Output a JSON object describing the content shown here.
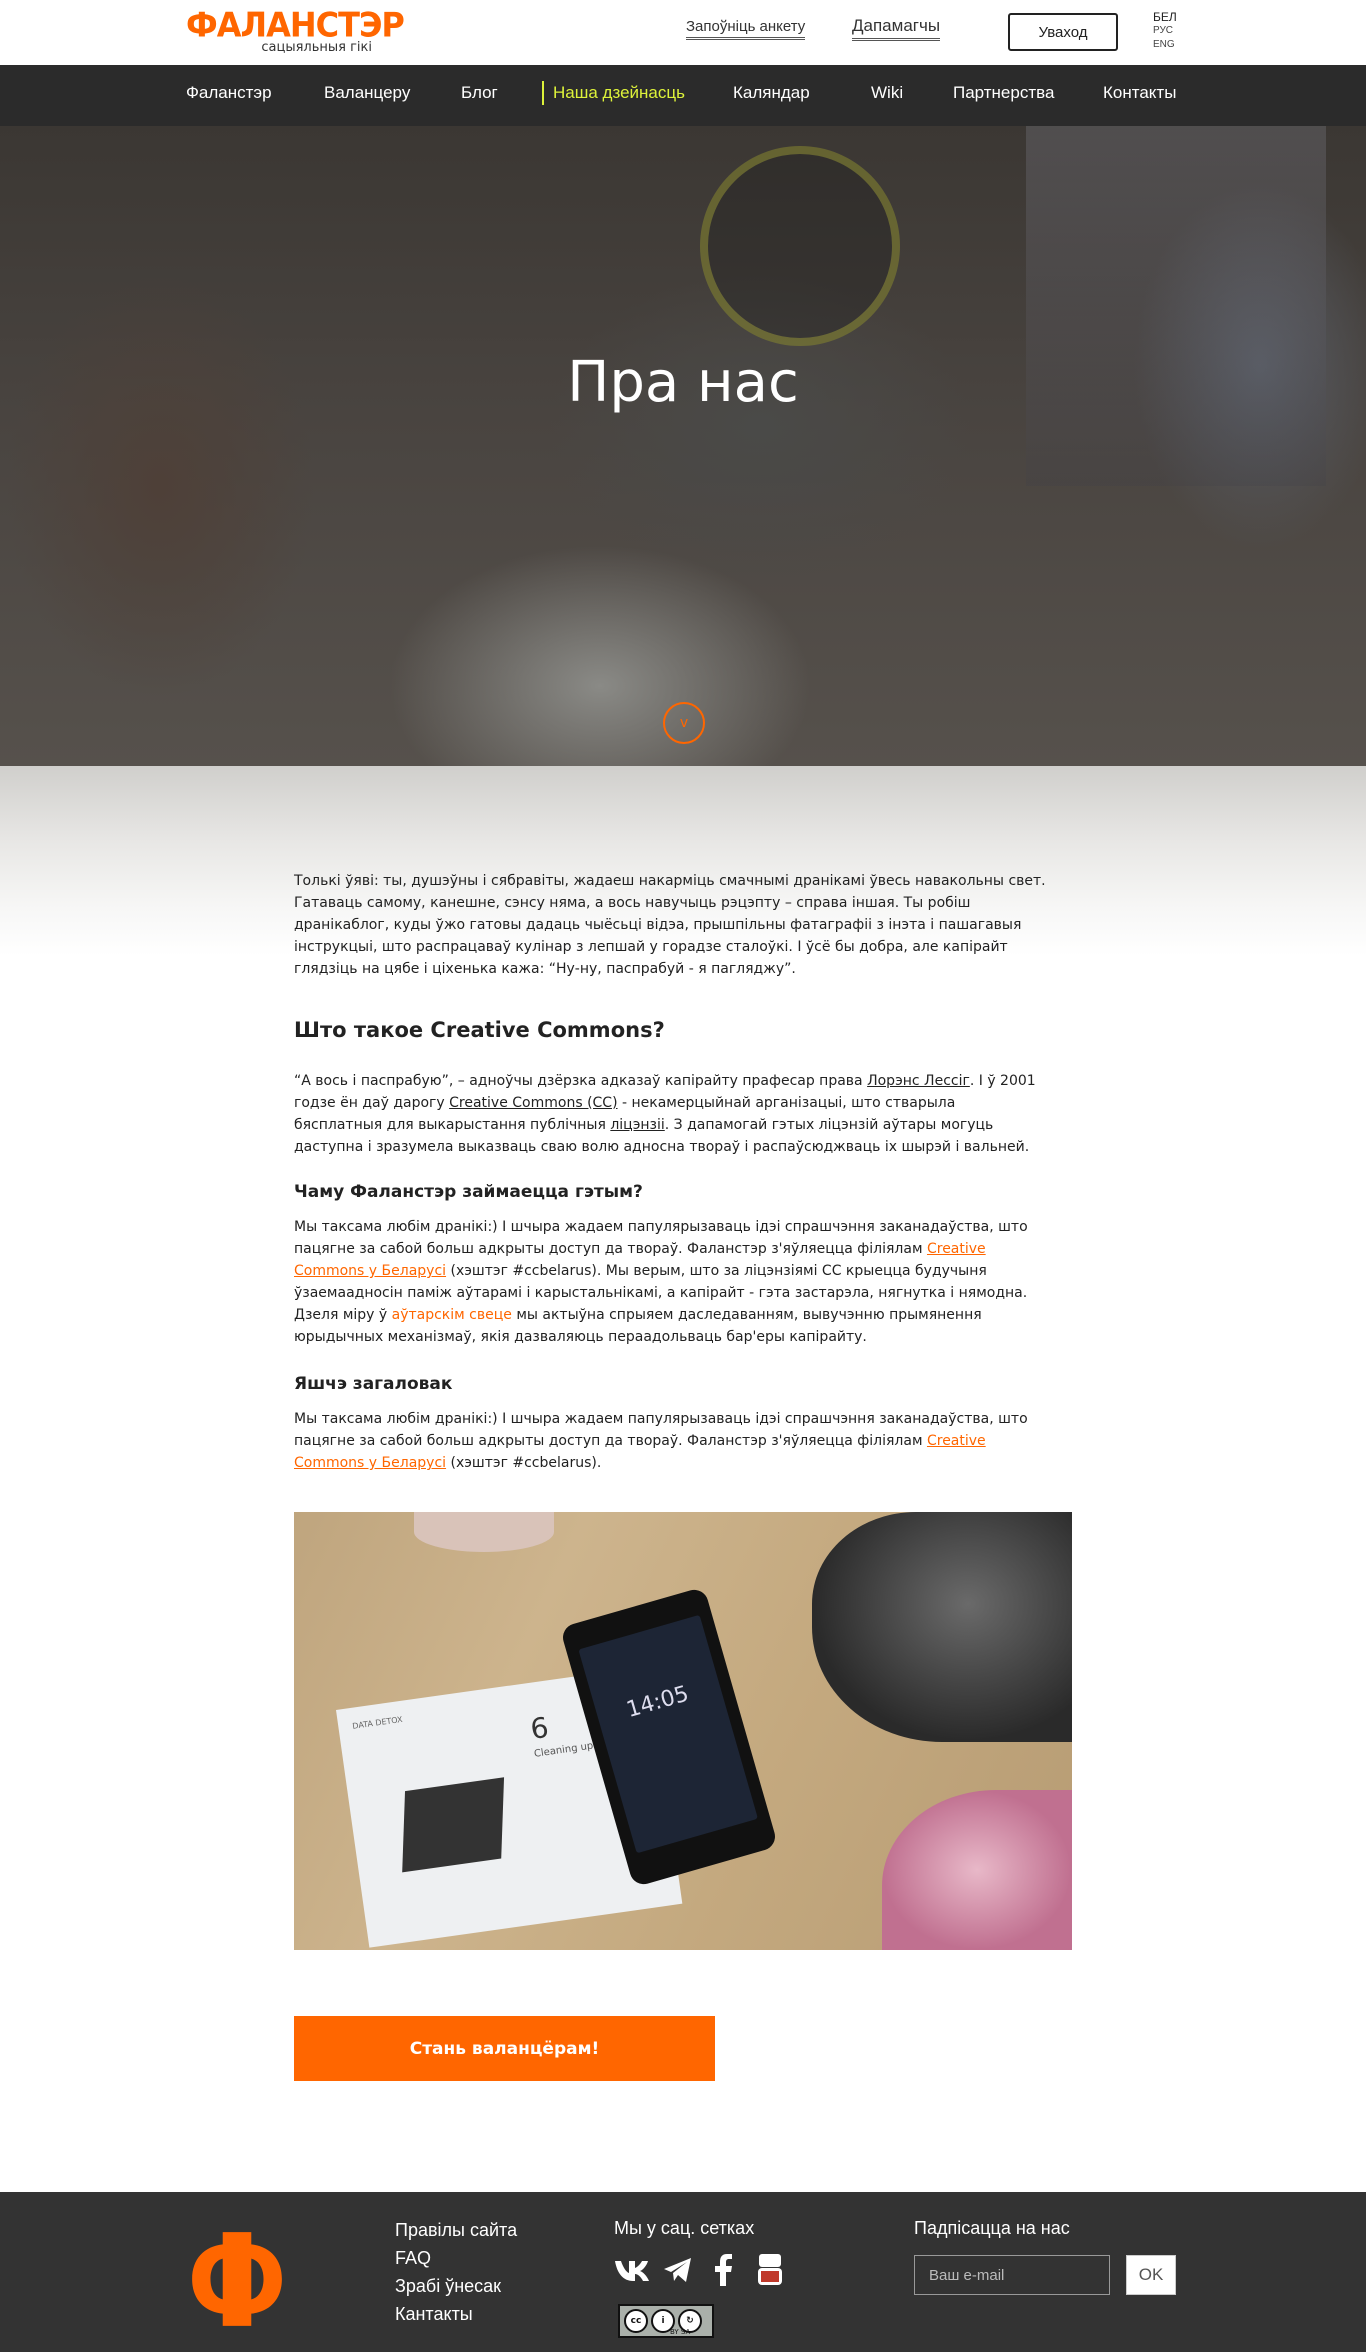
{
  "header": {
    "logo_text": "ФАЛАНСТЭР",
    "logo_sub": "сацыяльныя гікі",
    "fill_form": "Запоўніць анкету",
    "help": "Дапамагчы",
    "login": "Уваход",
    "languages": [
      "БЕЛ",
      "РУС",
      "ENG"
    ]
  },
  "nav": {
    "items": [
      "Фаланстэр",
      "Валанцеру",
      "Блог",
      "Наша дзейнасць",
      "Каляндар",
      "Wiki",
      "Партнерства",
      "Контакты"
    ],
    "active": "Наша дзейнасць"
  },
  "hero": {
    "title": "Пра нас",
    "scroll_icon": "chevron-down-icon"
  },
  "article": {
    "intro": "Толькі ўяві: ты, душэўны і сябравіты, жадаеш накарміць смачнымі дранікамі ўвесь навакольны свет. Гатаваць самому, канешне, сэнсу няма, а вось навучыць рэцэпту – справа іншая. Ты робіш дранікаблог, куды ўжо гатовы дадаць чыёсьці відэа, прышпільны фатаграфіі з інэта і пашагавыя інструкцыі, што распрацаваў кулінар з лепшай у горадзе сталоўкі. І ўсё бы добра, але капірайт глядзіць на цябе і ціхенька кажа: “Ну-ну, паспрабуй - я пагляджу”.",
    "h_cc": "Што такое Creative Commons?",
    "cc_p1": "“А вось і паспрабую”, – адноўчы дзёрзка адказаў капірайту прафесар права ",
    "cc_link_lessig": "Лорэнс Лессіг",
    "cc_p2": ". І ў 2001 годзе ён даў дарогу ",
    "cc_link_cc": "Creative Commons (CC)",
    "cc_p3": " - некамерцыйнай арганізацыі, што стварыла бясплатныя для выкарыстання публічныя ",
    "cc_link_lic": "ліцэнзіі",
    "cc_p4": ". З дапамогай гэтых ліцэнзій аўтары могуць даступна і зразумела выказваць сваю волю адносна твораў і распаўсюджваць іх шырэй і вальней.",
    "h_why": "Чаму Фаланстэр займаецца гэтым?",
    "why_p1": "Мы таксама любім дранікі:) І шчыра жадаем папулярызаваць ідэі спрашчэння заканадаўства, што пацягне за сабой больш адкрыты доступ да твораў. Фаланстэр з'яўляецца філіялам ",
    "why_link_cc_by": "Creative Commons у Беларусі",
    "why_p2": " (хэштэг #ccbelarus). Мы верым, што за ліцэнзіямі СС крыецца будучыня ўзаемаадносін паміж аўтарамі і карыстальнікамі, а капірайт - гэта застарэла, нягнутка і нямодна. Дзеля міру ў ",
    "why_link_authors": "аўтарскім свеце",
    "why_p3": " мы актыўна спрыяем даследаванням, вывучэнню прымянення юрыдычных механізмаў, якія дазваляюць пераадольваць бар'еры капірайту.",
    "h_more": "Яшчэ загаловак",
    "more_p1": "Мы таксама любім дранікі:) І шчыра жадаем папулярызаваць ідэі спрашчэння заканадаўства, што пацягне за сабой больш адкрыты доступ да твораў. Фаланстэр з'яўляецца філіялам ",
    "more_link": "Creative Commons у Беларусі",
    "more_p2": " (хэштэг #ccbelarus)."
  },
  "photo": {
    "card_number": "6",
    "card_caption": "Cleaning up",
    "card_brand": "DATA DETOX",
    "phone_time": "14:05"
  },
  "cta": {
    "label": "Стань валанцёрам!"
  },
  "footer": {
    "links": [
      "Правілы сайта",
      "FAQ",
      "Зрабі ўнесак",
      "Кантакты"
    ],
    "social_title": "Мы у сац. сетках",
    "social_icons": [
      "vk-icon",
      "telegram-icon",
      "facebook-icon",
      "youtube-icon"
    ],
    "license_badge": "BY SA",
    "subscribe_title": "Падпісацца на нас",
    "email_placeholder": "Ваш e-mail",
    "ok": "OK"
  },
  "colors": {
    "brand": "#ff6600",
    "nav_active": "#ddf23a",
    "dark": "#2b2b2b"
  }
}
